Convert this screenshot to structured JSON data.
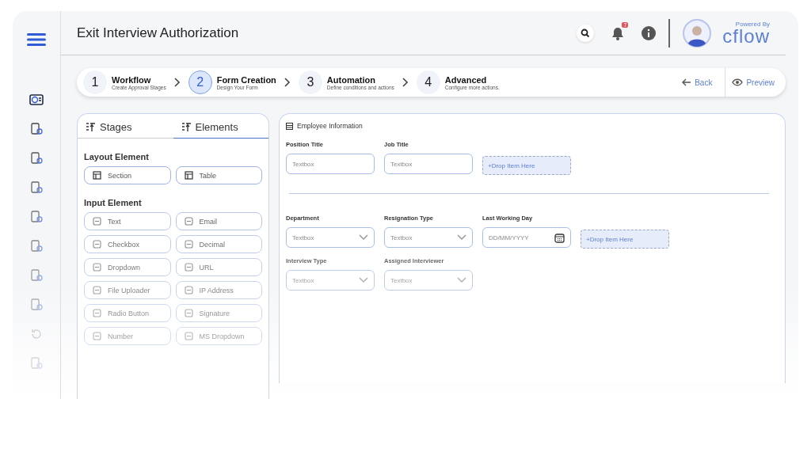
{
  "header": {
    "title": "Exit Interview Authorization",
    "notifications": "7",
    "logo": {
      "powered_by": "Powered By",
      "name": "cflow"
    }
  },
  "steps": [
    {
      "number": "1",
      "title": "Workflow",
      "subtitle": "Create Approval Stages",
      "selected": false
    },
    {
      "number": "2",
      "title": "Form Creation",
      "subtitle": "Design Your Form",
      "selected": true
    },
    {
      "number": "3",
      "title": "Automation",
      "subtitle": "Define conditions and actions",
      "selected": false
    },
    {
      "number": "4",
      "title": "Advanced",
      "subtitle": "Configure more actions.",
      "selected": false
    }
  ],
  "step_actions": {
    "back": "Back",
    "preview": "Preview"
  },
  "panel_tabs": [
    {
      "label": "Stages",
      "selected": false
    },
    {
      "label": "Elements",
      "selected": true
    }
  ],
  "layout_elements": {
    "heading": "Layout Element",
    "items": [
      "Section",
      "Table"
    ]
  },
  "input_elements": {
    "heading": "Input Element",
    "items": [
      "Text",
      "Email",
      "Checkbox",
      "Decimal",
      "Dropdown",
      "URL",
      "File Uploader",
      "IP Address",
      "Radio Button",
      "Signature",
      "Number",
      "MS Dropdown"
    ]
  },
  "form": {
    "section_title": "Employee Information",
    "rows": [
      [
        {
          "kind": "textbox",
          "label": "Position Title",
          "placeholder": "Textbox"
        },
        {
          "kind": "textbox",
          "label": "Job Title",
          "placeholder": "Textbox"
        },
        {
          "kind": "drop",
          "text": "+Drop Item Here"
        }
      ],
      [
        {
          "kind": "divider"
        }
      ],
      [
        {
          "kind": "dropdown",
          "label": "Department",
          "placeholder": "Textbox"
        },
        {
          "kind": "dropdown",
          "label": "Resignation Type",
          "placeholder": "Textbox"
        },
        {
          "kind": "date",
          "label": "Last Working Day",
          "placeholder": "DD/MM/YYYY"
        },
        {
          "kind": "drop",
          "text": "+Drop Item Here"
        }
      ],
      [
        {
          "kind": "dropdown",
          "label": "Interview Type",
          "placeholder": "Textbox"
        },
        {
          "kind": "dropdown",
          "label": "Assigned Interviewer",
          "placeholder": "Textbox"
        }
      ]
    ]
  }
}
